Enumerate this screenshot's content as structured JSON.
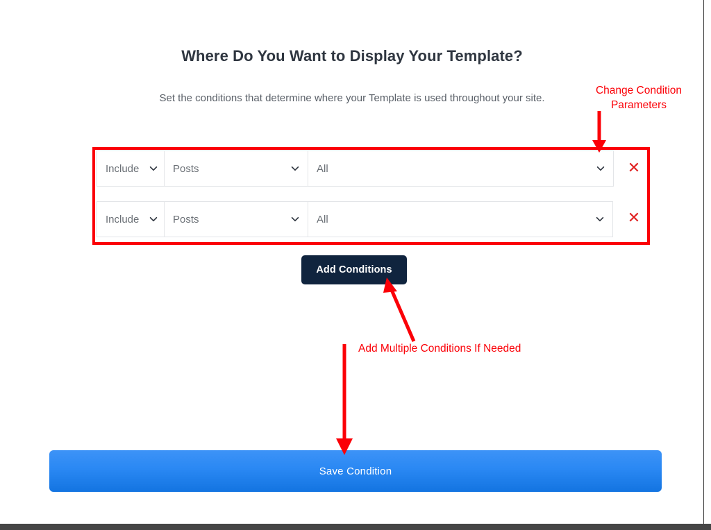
{
  "header": {
    "title": "Where Do You Want to Display Your Template?",
    "subtitle": "Set the conditions that determine where your Template is used throughout your site."
  },
  "conditions": {
    "rows": [
      {
        "include": "Include",
        "type": "Posts",
        "value": "All",
        "remove_glyph": "✕"
      },
      {
        "include": "Include",
        "type": "Posts",
        "value": "All",
        "remove_glyph": "✕"
      }
    ]
  },
  "actions": {
    "add_conditions_label": "Add Conditions",
    "save_condition_label": "Save Condition"
  },
  "annotations": {
    "change_parameters": "Change Condition\nParameters",
    "add_multiple": "Add Multiple Conditions If Needed"
  },
  "colors": {
    "annotation_red": "#fb0007",
    "highlight_box_red": "#fb0007",
    "remove_icon_red": "#e02020",
    "add_button_navy": "#10243e",
    "save_button_blue_top": "#3d93f7",
    "save_button_blue_bottom": "#1374e1",
    "title_text": "#2f3640",
    "subtitle_text": "#5a6068",
    "field_text": "#6b7076",
    "field_border": "#e3e5e8",
    "bottom_bar": "#454545"
  },
  "icons": {
    "chevron_down": "chevron-down-icon",
    "close": "close-icon"
  }
}
